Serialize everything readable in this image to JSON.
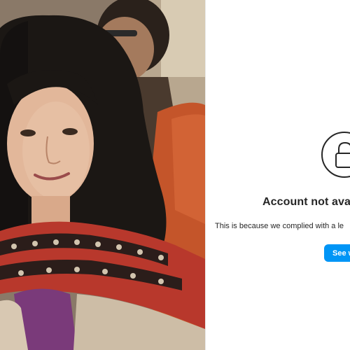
{
  "message": {
    "title": "Account not ava",
    "body": "This is because we complied with a le",
    "see_more_label": "See w"
  },
  "colors": {
    "button_blue": "#0095f6",
    "text_dark": "#262626",
    "scarf_red": "#b8382c",
    "hair_dark": "#1b1714",
    "jacket_orange": "#c4552a",
    "blouse_purple": "#7a3a7a"
  },
  "icons": {
    "lock": "lock-icon"
  }
}
